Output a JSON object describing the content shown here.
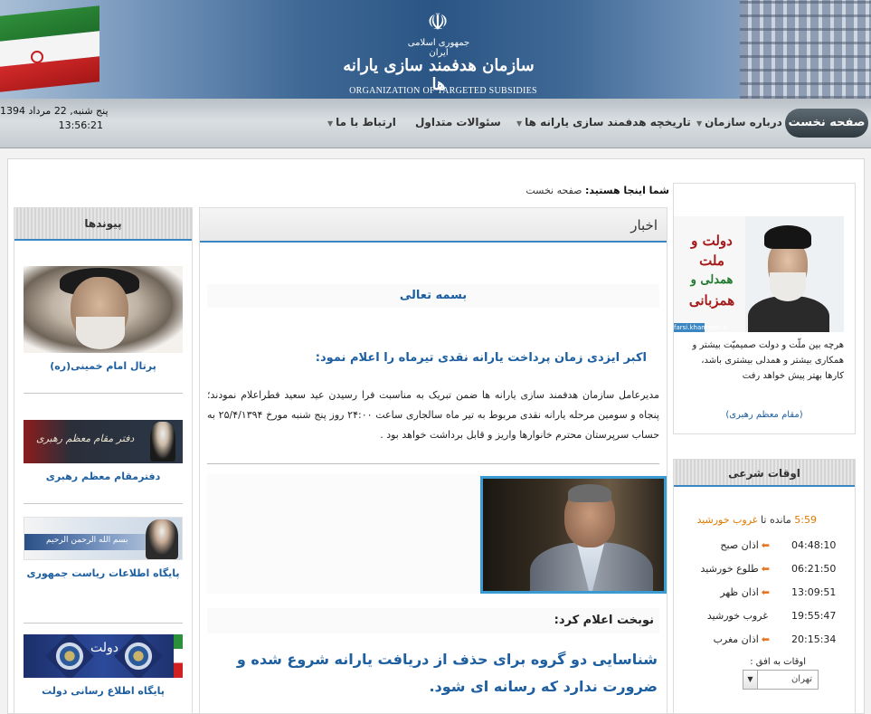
{
  "header": {
    "emblem": "☫",
    "title_small": "جمهوری اسلامی ایران",
    "title_fa": "سازمان هدفمند سازی یارانه ها",
    "title_en": "ORGANIZATION OF TARGETED SUBSIDIES"
  },
  "nav": {
    "date": "پنج شنبه, 22 مرداد 1394",
    "time": "13:56:21",
    "home": "صفحه نخست",
    "items": [
      {
        "label": "درباره سازمان",
        "arrow": "▼"
      },
      {
        "label": "تاریخچه هدفمند سازی یارانه ها",
        "arrow": "▼"
      },
      {
        "label": "سئوالات متداول"
      },
      {
        "label": "ارتباط با ما",
        "arrow": "▼"
      }
    ]
  },
  "breadcrumb": {
    "label": "شما اینجا هستید:",
    "current": "صفحه نخست"
  },
  "links": {
    "title": "پیوندها",
    "items": [
      {
        "label": "پرتال امام خمینی(ره)"
      },
      {
        "label": "دفترمقام معظم رهبری",
        "img_text": "دفتر مقام معظم رهبری"
      },
      {
        "label": "پایگاه اطلاعات ریاست جمهوری",
        "img_text": "بسم الله الرحمن الرحیم"
      },
      {
        "label": "پایگاه اطلاع رسانی دولت",
        "img_text": "دولت"
      }
    ]
  },
  "news": {
    "title": "اخبار",
    "bismillah": "بسمه تعالی",
    "headline": "اکبر ایزدی زمان پرداخت یارانه نقدی تیرماه را اعلام نمود:",
    "body": "مدیرعامل سازمان هدفمند سازی یارانه ها ضمن تبریک به مناسبت فرا رسیدن عید سعید فطراعلام نمودند؛ پنجاه و سومین مرحله یارانه نقدی مربوط به تیر ماه سالجاری ساعت ۲۴:۰۰ روز پنج شنبه مورخ ۲۵/۴/۱۳۹۴ به حساب سرپرستان محترم خانوارها واریز و قابل برداشت خواهد بود .",
    "quote_label": "نوبخت اعلام کرد:",
    "quote": "شناسایی دو گروه برای حذف از دریافت یارانه شروع شده و ضرورت ندارد که رسانه ای شود."
  },
  "leader": {
    "calligraphy_1": "دولت و ملت",
    "calligraphy_2": "همدلی و",
    "calligraphy_3": "همزبانی",
    "img_tag": "farsi.khamenei.ir",
    "quote": "هرچه بین ملّت و دولت صمیمیّت بیشتر و همکاری بیشتر و همدلی بیشتری باشد، کارها بهتر پیش خواهد رفت",
    "link": "(مقام معظم رهبری)"
  },
  "prayer": {
    "title": "اوقات شرعی",
    "remain_value": "5:59",
    "remain_mid": "مانده تا",
    "remain_link": "غروب خورشید",
    "rows": [
      {
        "name": "اذان صبح",
        "time": "04:48:10",
        "arrow": true
      },
      {
        "name": "طلوع خورشید",
        "time": "06:21:50",
        "arrow": true
      },
      {
        "name": "اذان ظهر",
        "time": "13:09:51",
        "arrow": true
      },
      {
        "name": "غروب خورشید",
        "time": "19:55:47",
        "arrow": false
      },
      {
        "name": "اذان مغرب",
        "time": "20:15:34",
        "arrow": true
      }
    ],
    "ufuq_label": "اوقات به افق :",
    "city": "تهران",
    "city_options": [
      "تهران"
    ]
  },
  "colors": {
    "accent": "#3a86c2",
    "link": "#1d5fa0",
    "orange": "#e07a00"
  }
}
